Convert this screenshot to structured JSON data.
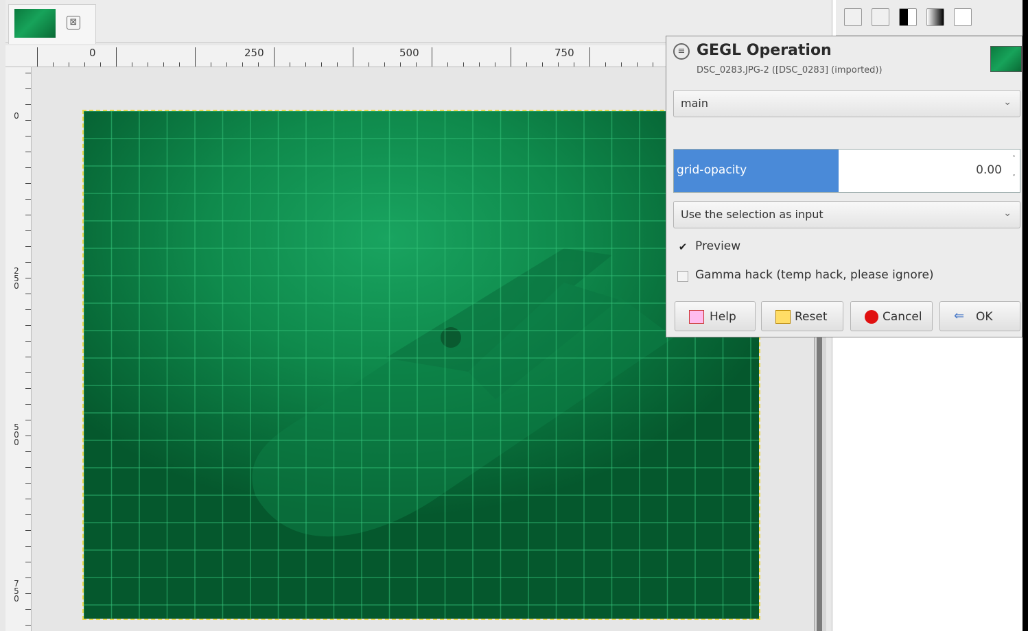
{
  "image_tab": {
    "close_glyph": "⊠"
  },
  "ruler_h_labels": [
    "0",
    "250",
    "500",
    "750"
  ],
  "ruler_v_labels": [
    "0",
    "250",
    "500",
    "750"
  ],
  "ruler_corner_glyph": "▸",
  "dialog": {
    "title": "GEGL Operation",
    "subtitle": "DSC_0283.JPG-2 ([DSC_0283] (imported))",
    "operation_select": "main",
    "param_label": "grid-opacity",
    "param_value": "0.00",
    "input_select": "Use the selection as input",
    "preview_label": "Preview",
    "preview_checked": true,
    "gamma_label": "Gamma hack (temp hack, please ignore)",
    "gamma_checked": false,
    "buttons": {
      "help": "Help",
      "reset": "Reset",
      "cancel": "Cancel",
      "ok": "OK"
    },
    "combo_arrow": "⌄",
    "spin_up": "˄",
    "spin_down": "˅",
    "check_mark": "✔"
  },
  "colors": {
    "image_green": "#0f8a4c",
    "selection_blue": "#4a8ad8",
    "cancel_red": "#e01010"
  }
}
